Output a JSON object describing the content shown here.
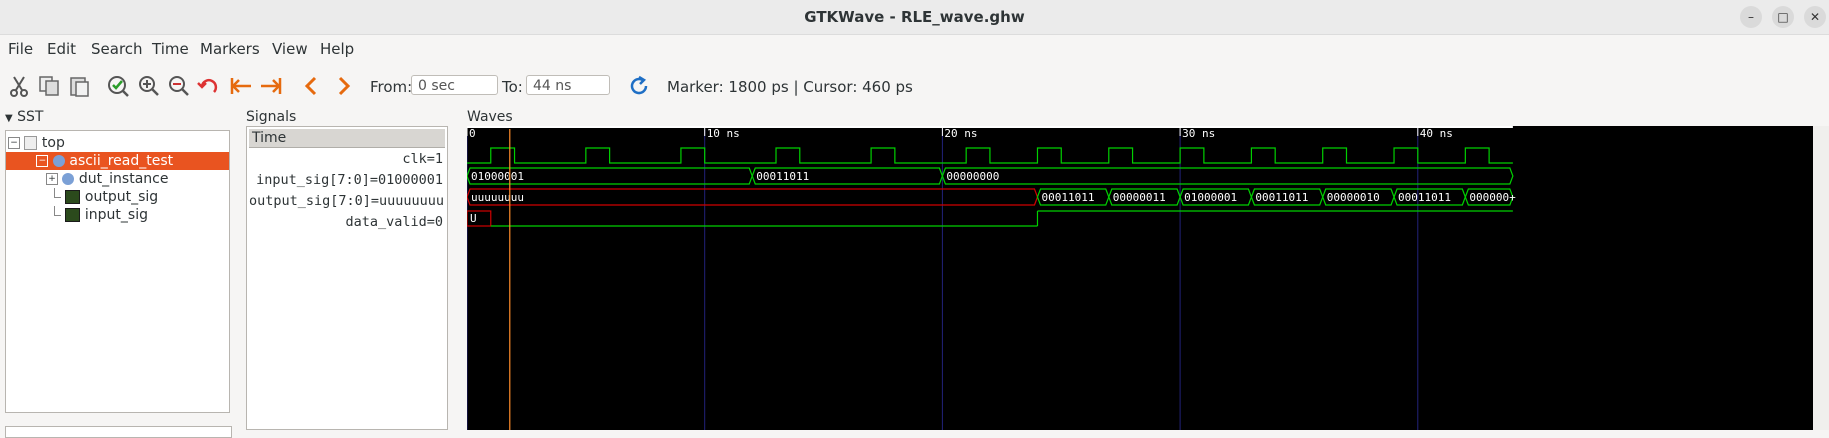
{
  "window": {
    "title": "GTKWave - RLE_wave.ghw",
    "controls": {
      "minimize": "–",
      "maximize": "□",
      "close": "✕"
    }
  },
  "menu": [
    "File",
    "Edit",
    "Search",
    "Time",
    "Markers",
    "View",
    "Help"
  ],
  "toolbar": {
    "from_label": "From:",
    "from_value": "0 sec",
    "to_label": "To:",
    "to_value": "44 ns",
    "status": "Marker: 1800 ps  |  Cursor: 460 ps",
    "icons": [
      "cut-icon",
      "copy-icon",
      "paste-icon",
      "select-all-icon",
      "zoom-in-icon",
      "zoom-out-icon",
      "undo-zoom-icon",
      "zoom-to-start-icon",
      "zoom-to-end-icon",
      "previous-icon",
      "next-icon",
      "reload-icon"
    ]
  },
  "sst": {
    "title": "SST",
    "tree": [
      {
        "label": "top",
        "level": 0,
        "expander": "minus",
        "selected": false
      },
      {
        "label": "ascii_read_test",
        "level": 1,
        "expander": "minus",
        "selected": true
      },
      {
        "label": "dut_instance",
        "level": 2,
        "expander": "plus",
        "selected": false
      },
      {
        "label": "output_sig",
        "level": 2,
        "expander": "none",
        "selected": false
      },
      {
        "label": "input_sig",
        "level": 2,
        "expander": "none",
        "selected": false
      }
    ]
  },
  "signals": {
    "title": "Signals",
    "header": "Time",
    "rows": [
      "clk=1",
      "input_sig[7:0]=01000001",
      "output_sig[7:0]=uuuuuuuu",
      "data_valid=0"
    ]
  },
  "waves": {
    "title": "Waves",
    "ticks": [
      {
        "label": "0",
        "t": 0
      },
      {
        "label": "10 ns",
        "t": 10
      },
      {
        "label": "20 ns",
        "t": 20
      },
      {
        "label": "30 ns",
        "t": 30
      },
      {
        "label": "40 ns",
        "t": 40
      }
    ],
    "t_end_ns": 44,
    "marker_ns": 1.8,
    "clk_rise_ns": [
      1.0,
      5.0,
      9.0,
      13.0,
      17.0,
      21.0,
      24.0,
      27.0,
      30.0,
      33.0,
      36.0,
      39.0,
      42.0
    ],
    "clk_high_ns": 1.0,
    "input_sig": [
      {
        "start": 0,
        "end": 12,
        "value": "01000001"
      },
      {
        "start": 12,
        "end": 20,
        "value": "00011011"
      },
      {
        "start": 20,
        "end": 44,
        "value": "00000000"
      }
    ],
    "output_sig": [
      {
        "start": 0,
        "end": 24,
        "value": "uuuuuuuu",
        "state": "undefined"
      },
      {
        "start": 24,
        "end": 27,
        "value": "00011011",
        "state": "valid"
      },
      {
        "start": 27,
        "end": 30,
        "value": "00000011",
        "state": "valid"
      },
      {
        "start": 30,
        "end": 33,
        "value": "01000001",
        "state": "valid"
      },
      {
        "start": 33,
        "end": 36,
        "value": "00011011",
        "state": "valid"
      },
      {
        "start": 36,
        "end": 39,
        "value": "00000010",
        "state": "valid"
      },
      {
        "start": 39,
        "end": 42,
        "value": "00011011",
        "state": "valid"
      },
      {
        "start": 42,
        "end": 44,
        "value": "000000+",
        "state": "valid"
      }
    ],
    "data_valid": [
      {
        "start": 0,
        "end": 1,
        "value": "U",
        "state": "undefined"
      },
      {
        "start": 1,
        "end": 24,
        "value": "0",
        "state": "low"
      },
      {
        "start": 24,
        "end": 44,
        "value": "1",
        "state": "high"
      }
    ],
    "colors": {
      "trace": "#00d000",
      "undefined": "#d00000",
      "grid": "#22227a",
      "marker": "#ff8c2a",
      "text": "#ffffff"
    }
  }
}
